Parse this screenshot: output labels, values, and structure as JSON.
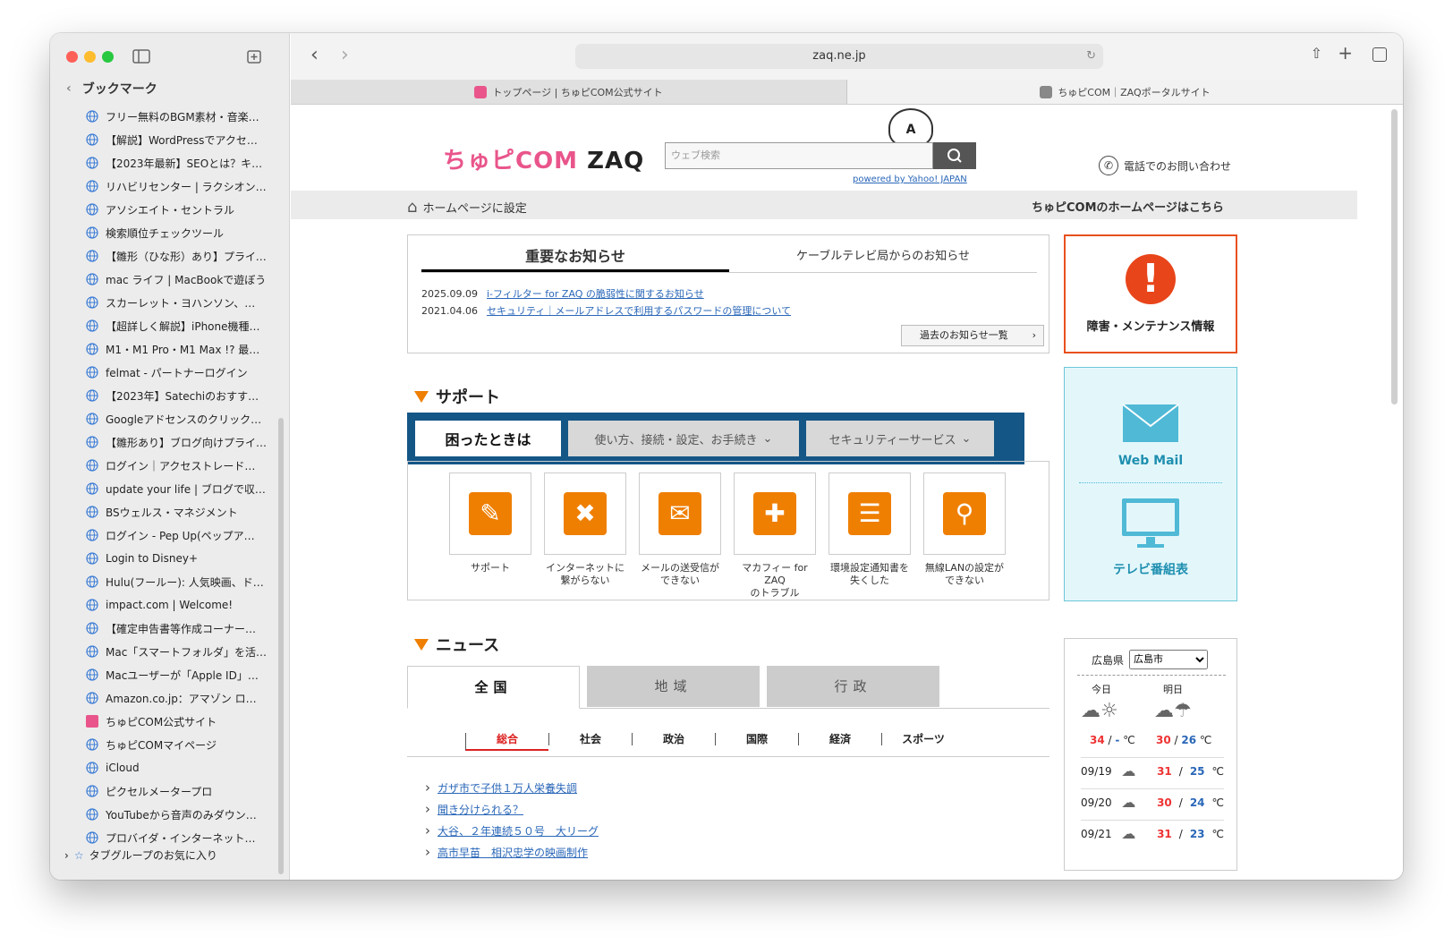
{
  "browser": {
    "url": "zaq.ne.jp",
    "tabs": [
      "トップページ | ちゅピCOM公式サイト",
      "ちゅピCOM｜ZAQポータルサイト"
    ],
    "bookmarks_header": "ブックマーク",
    "tab_group": "タブグループのお気に入り"
  },
  "bookmarks": [
    "フリー無料のBGM素材・音楽…",
    "【解説】WordPressでアクセス…",
    "【2023年最新】SEOとは？キ…",
    "リハビリセンター | ラクシオン…",
    "アソシエイト・セントラル",
    "検索順位チェックツール",
    "【雛形（ひな形）あり】プライバ…",
    "mac ライフ | MacBookで遊ぼう",
    "スカーレット・ヨハンソン、…",
    "【超詳しく解説】iPhone機種変…",
    "M1・M1 Pro・M1 Max !? 最…",
    "felmat - パートナーログイン",
    "【2023年】Satechiのおすすめ…",
    "Googleアドセンスのクリック…",
    "【雛形あり】ブログ向けプライ…",
    "ログイン｜アクセストレード…",
    "update your life | ブログで収…",
    "BSウェルス・マネジメント",
    "ログイン - Pep Up(ペップア…",
    "Login to Disney+",
    "Hulu(フールー): 人気映画、ド…",
    "impact.com | Welcome!",
    "【確定申告書等作成コーナー】-…",
    "Mac「スマートフォルダ」を活…",
    "Macユーザーが「Apple ID」…",
    "Amazon.co.jp：アマゾン ロ…",
    "ちゅピCOM公式サイト",
    "ちゅピCOMマイページ",
    "iCloud",
    "ピクセルメータープロ",
    "YouTubeから音声のみダウン…",
    "プロバイダ・インターネット…"
  ],
  "header": {
    "logo": "ちゅピCOM ZAQ",
    "search_placeholder": "ウェブ検索",
    "powered": "powered by Yahoo! JAPAN",
    "phone": "電話でのお問い合わせ",
    "mascot": "A",
    "home_set": "ホームページに設定",
    "home_link": "ちゅピCOMのホームページはこちら"
  },
  "notice": {
    "tab1": "重要なお知らせ",
    "tab2": "ケーブルテレビ局からのお知らせ",
    "items": [
      {
        "date": "2025.09.09",
        "text": "i-フィルター for ZAQ の脆弱性に関するお知らせ"
      },
      {
        "date": "2021.04.06",
        "text": "セキュリティ｜メールアドレスで利用するパスワードの管理について"
      }
    ],
    "past": "過去のお知らせ一覧"
  },
  "side_panels": {
    "trouble": "障害・メンテナンス情報",
    "mail": "Web Mail",
    "tv": "テレビ番組表"
  },
  "support": {
    "title": "サポート",
    "tabs": [
      "困ったときは",
      "使い方、接続・設定、お手続き",
      "セキュリティーサービス"
    ],
    "cards": [
      "サポート",
      "インターネットに\n繋がらない",
      "メールの送受信が\nできない",
      "マカフィー for ZAQ\nのトラブル",
      "環境設定通知書を\n失くした",
      "無線LANの設定が\nできない"
    ]
  },
  "news": {
    "title": "ニュース",
    "tabs": [
      "全国",
      "地域",
      "行政"
    ],
    "cats": [
      "総合",
      "社会",
      "政治",
      "国際",
      "経済",
      "スポーツ"
    ],
    "items": [
      "ガザ市で子供１万人栄養失調",
      "聞き分けられる？",
      "大谷、２年連続５０号　大リーグ",
      "高市早苗　相沢忠学の映画制作"
    ]
  },
  "weather": {
    "pref": "広島県",
    "city": "広島市",
    "today": "今日",
    "tomorrow": "明日",
    "t_hi": "34",
    "t_lo": "-",
    "m_hi": "30",
    "m_lo": "26",
    "unit": "℃",
    "days": [
      {
        "d": "09/19",
        "hi": "31",
        "lo": "25"
      },
      {
        "d": "09/20",
        "hi": "30",
        "lo": "24"
      },
      {
        "d": "09/21",
        "hi": "31",
        "lo": "23"
      }
    ]
  },
  "colors": {
    "accent": "#ef7f00",
    "support_border": "#145686",
    "trouble": "#e8451a",
    "mail": "#4fb9d6"
  }
}
